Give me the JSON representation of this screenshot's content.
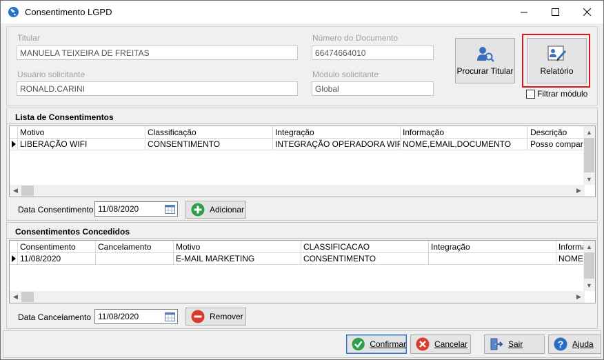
{
  "window": {
    "title": "Consentimento LGPD"
  },
  "form": {
    "titular_label": "Titular",
    "titular_value": "MANUELA TEIXEIRA DE FREITAS",
    "numero_label": "Número do Documento",
    "numero_value": "66474664010",
    "usuario_label": "Usuário solicitante",
    "usuario_value": "RONALD.CARINI",
    "modulo_label": "Módulo solicitante",
    "modulo_value": "Global"
  },
  "actions": {
    "procurar_label": "Procurar Titular",
    "relatorio_label": "Relatório",
    "filtrar_label": "Filtrar módulo",
    "filtrar_checked": false
  },
  "lista": {
    "title": "Lista de Consentimentos",
    "columns": [
      "Motivo",
      "Classificação",
      "Integração",
      "Informação",
      "Descrição"
    ],
    "rows": [
      [
        "LIBERAÇÃO WIFI",
        "CONSENTIMENTO",
        "INTEGRAÇÃO OPERADORA WIFI",
        "NOME,EMAIL,DOCUMENTO",
        "Posso comparti"
      ]
    ],
    "date_label": "Data Consentimento",
    "date_value": "11/08/2020",
    "add_label": "Adicionar"
  },
  "concedidos": {
    "title": "Consentimentos Concedidos",
    "columns": [
      "Consentimento",
      "Cancelamento",
      "Motivo",
      "CLASSIFICACAO",
      "Integração",
      "Informa"
    ],
    "rows": [
      [
        "11/08/2020",
        "",
        "E-MAIL MARKETING",
        "CONSENTIMENTO",
        "",
        "NOME,I"
      ]
    ],
    "date_label": "Data Cancelamento",
    "date_value": "11/08/2020",
    "remove_label": "Remover"
  },
  "footer": {
    "confirmar_label": "Confirmar",
    "cancelar_label": "Cancelar",
    "sair_label": "Sair",
    "ajuda_label": "Ajuda"
  },
  "colors": {
    "highlight": "#e0121e",
    "confirm_green": "#2f9e4a",
    "cancel_red": "#d83b2b",
    "help_blue": "#2b6cc4"
  }
}
